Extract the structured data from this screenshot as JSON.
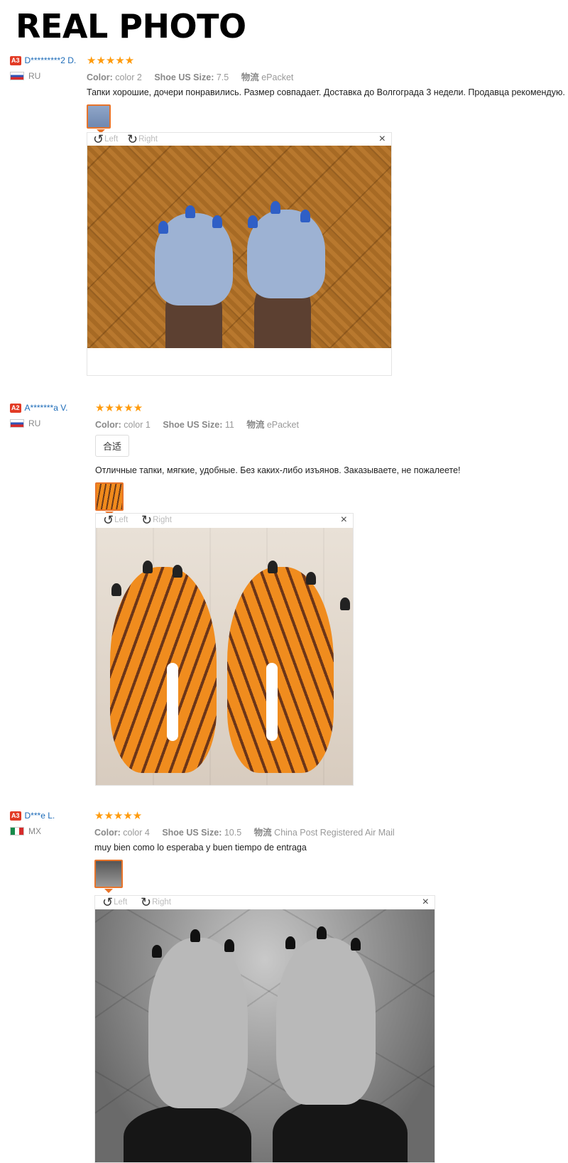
{
  "page_title": "REAL PHOTO",
  "labels": {
    "color": "Color:",
    "size": "Shoe US Size:",
    "shipping": "物流",
    "rotate_left": "Left",
    "rotate_right": "Right",
    "close": "×"
  },
  "stars": "★★★★★",
  "reviews": [
    {
      "badge": "A3",
      "user": "D*********2 D.",
      "country": "RU",
      "rating": 5,
      "color": "color 2",
      "size": "7.5",
      "shipping": "ePacket",
      "text": "Тапки хорошие, дочери понравились. Размер совпадает. Доставка до Волгограда 3 недели. Продавца рекомендую."
    },
    {
      "badge": "A2",
      "user": "A*******a V.",
      "country": "RU",
      "rating": 5,
      "color": "color 1",
      "size": "11",
      "shipping": "ePacket",
      "tag": "合适",
      "text": "Отличные тапки, мягкие, удобные. Без каких-либо изъянов. Заказываете, не пожалеете!"
    },
    {
      "badge": "A3",
      "user": "D***e L.",
      "country": "MX",
      "rating": 5,
      "color": "color 4",
      "size": "10.5",
      "shipping": "China Post Registered Air Mail",
      "text": "muy bien como lo esperaba y buen tiempo de entraga"
    }
  ]
}
